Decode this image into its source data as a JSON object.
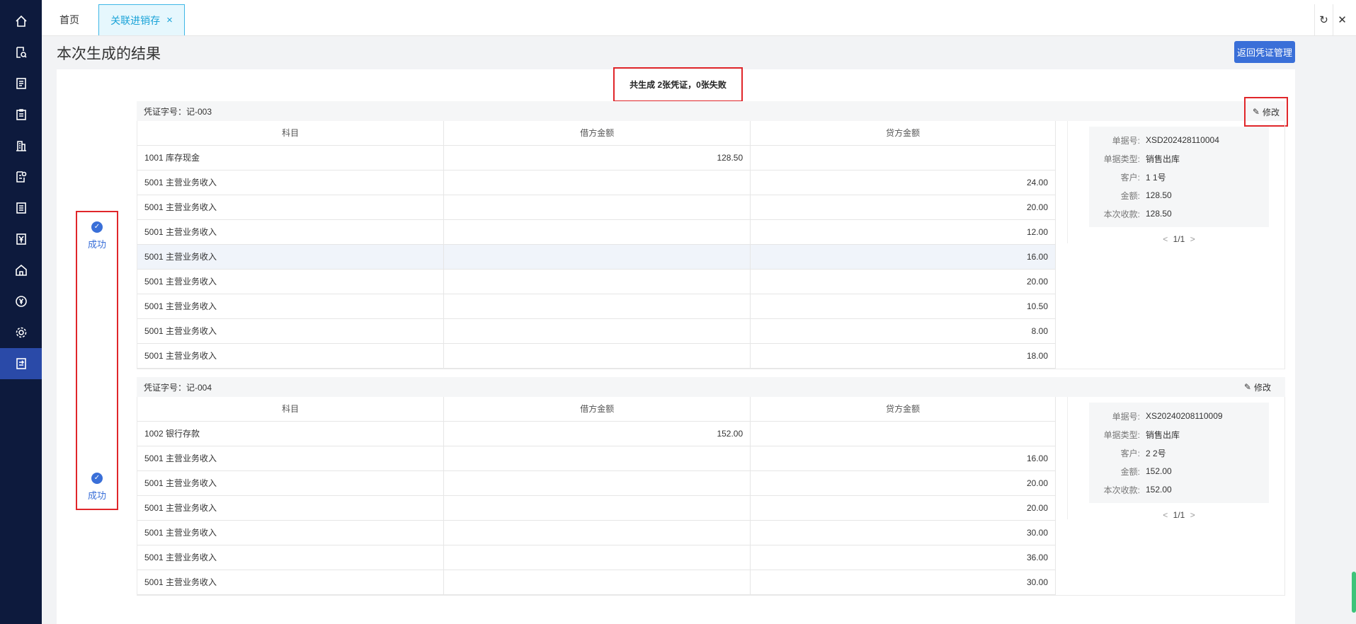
{
  "tabs": {
    "home": "首页",
    "active": "关联进销存",
    "close": "×"
  },
  "window_controls": {
    "refresh": "↻",
    "close": "✕"
  },
  "page_title": "本次生成的结果",
  "back_button": "返回凭证管理",
  "summary": "共生成 2张凭证，0张失败",
  "status_label": "成功",
  "columns": [
    "科目",
    "借方金额",
    "贷方金额"
  ],
  "edit_label": "修改",
  "doc_labels": {
    "no": "单据号:",
    "type": "单据类型:",
    "customer": "客户:",
    "amount": "金额:",
    "received": "本次收款:"
  },
  "vouchers": [
    {
      "header": "凭证字号：记-003",
      "rows": [
        [
          "1001 库存现金",
          "128.50",
          ""
        ],
        [
          "5001 主营业务收入",
          "",
          "24.00"
        ],
        [
          "5001 主营业务收入",
          "",
          "20.00"
        ],
        [
          "5001 主营业务收入",
          "",
          "12.00"
        ],
        [
          "5001 主营业务收入",
          "",
          "16.00"
        ],
        [
          "5001 主营业务收入",
          "",
          "20.00"
        ],
        [
          "5001 主营业务收入",
          "",
          "10.50"
        ],
        [
          "5001 主营业务收入",
          "",
          "8.00"
        ],
        [
          "5001 主营业务收入",
          "",
          "18.00"
        ]
      ],
      "doc": {
        "no": "XSD202428110004",
        "type": "销售出库",
        "customer": "1 1号",
        "amount": "128.50",
        "received": "128.50"
      },
      "pager": {
        "prev": "<",
        "page": "1/1",
        "next": ">"
      }
    },
    {
      "header": "凭证字号：记-004",
      "rows": [
        [
          "1002 银行存款",
          "152.00",
          ""
        ],
        [
          "5001 主营业务收入",
          "",
          "16.00"
        ],
        [
          "5001 主营业务收入",
          "",
          "20.00"
        ],
        [
          "5001 主营业务收入",
          "",
          "20.00"
        ],
        [
          "5001 主营业务收入",
          "",
          "30.00"
        ],
        [
          "5001 主营业务收入",
          "",
          "36.00"
        ],
        [
          "5001 主营业务收入",
          "",
          "30.00"
        ]
      ],
      "doc": {
        "no": "XS20240208110009",
        "type": "销售出库",
        "customer": "2 2号",
        "amount": "152.00",
        "received": "152.00"
      },
      "pager": {
        "prev": "<",
        "page": "1/1",
        "next": ">"
      }
    }
  ]
}
